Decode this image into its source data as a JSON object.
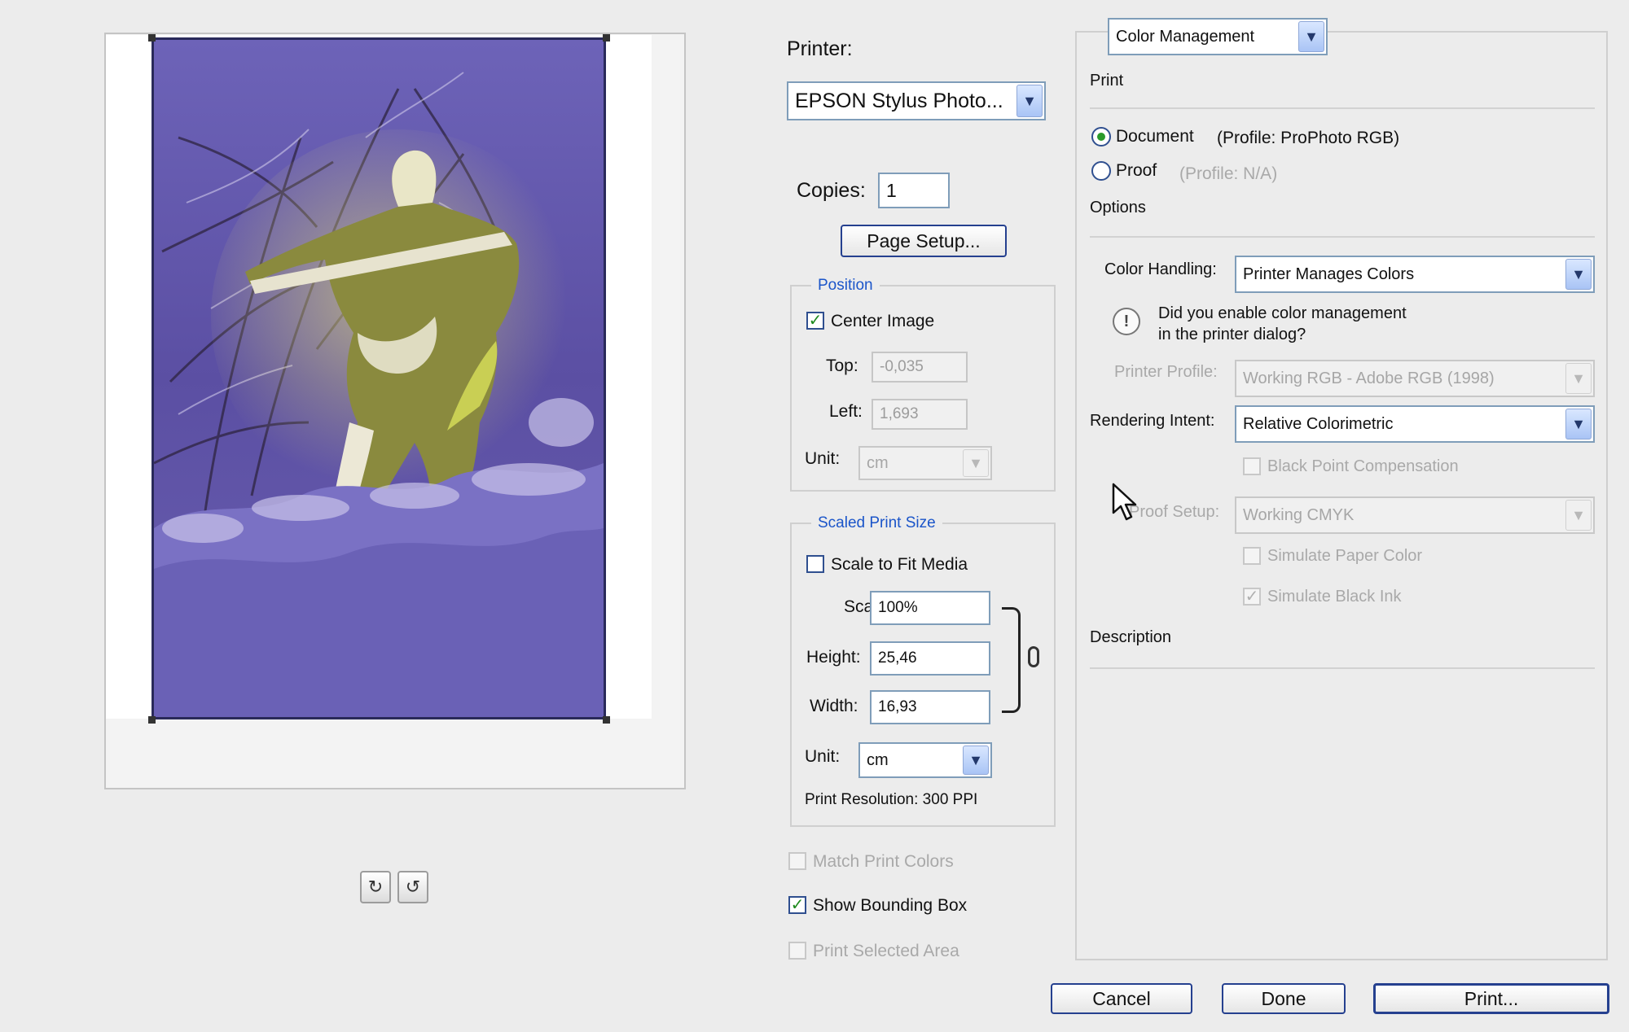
{
  "preview": {
    "icons": [
      "portrait-icon",
      "landscape-icon"
    ]
  },
  "printer": {
    "label": "Printer:",
    "value": "EPSON Stylus Photo..."
  },
  "copies": {
    "label": "Copies:",
    "value": "1"
  },
  "page_setup_label": "Page Setup...",
  "position": {
    "title": "Position",
    "center_image_label": "Center Image",
    "top_label": "Top:",
    "top_value": "-0,035",
    "left_label": "Left:",
    "left_value": "1,693",
    "unit_label": "Unit:",
    "unit_value": "cm"
  },
  "scaled_print_size": {
    "title": "Scaled Print Size",
    "scale_to_fit_label": "Scale to Fit Media",
    "scale_label": "Scale:",
    "scale_value": "100%",
    "height_label": "Height:",
    "height_value": "25,46",
    "width_label": "Width:",
    "width_value": "16,93",
    "unit_label": "Unit:",
    "unit_value": "cm",
    "resolution_text": "Print Resolution: 300 PPI"
  },
  "options_bottom": {
    "match_print_colors": "Match Print Colors",
    "show_bounding_box": "Show Bounding Box",
    "print_selected_area": "Print Selected Area"
  },
  "color_management": {
    "section_select": "Color Management",
    "print_heading": "Print",
    "document_label": "Document",
    "document_profile": "(Profile: ProPhoto RGB)",
    "proof_label": "Proof",
    "proof_profile": "(Profile: N/A)",
    "options_heading": "Options",
    "color_handling_label": "Color Handling:",
    "color_handling_value": "Printer Manages Colors",
    "warning_text_line1": "Did you enable color management",
    "warning_text_line2": "in the printer dialog?",
    "printer_profile_label": "Printer Profile:",
    "printer_profile_value": "Working RGB - Adobe RGB (1998)",
    "rendering_intent_label": "Rendering Intent:",
    "rendering_intent_value": "Relative Colorimetric",
    "black_point_label": "Black Point Compensation",
    "proof_setup_label": "Proof Setup:",
    "proof_setup_value": "Working CMYK",
    "simulate_paper_label": "Simulate Paper Color",
    "simulate_ink_label": "Simulate Black Ink",
    "description_heading": "Description"
  },
  "buttons": {
    "cancel": "Cancel",
    "done": "Done",
    "print": "Print..."
  },
  "colors": {
    "accent_blue": "#1b55c9",
    "check_green": "#1e8a1e",
    "photo_sky": "#5f55a6"
  }
}
